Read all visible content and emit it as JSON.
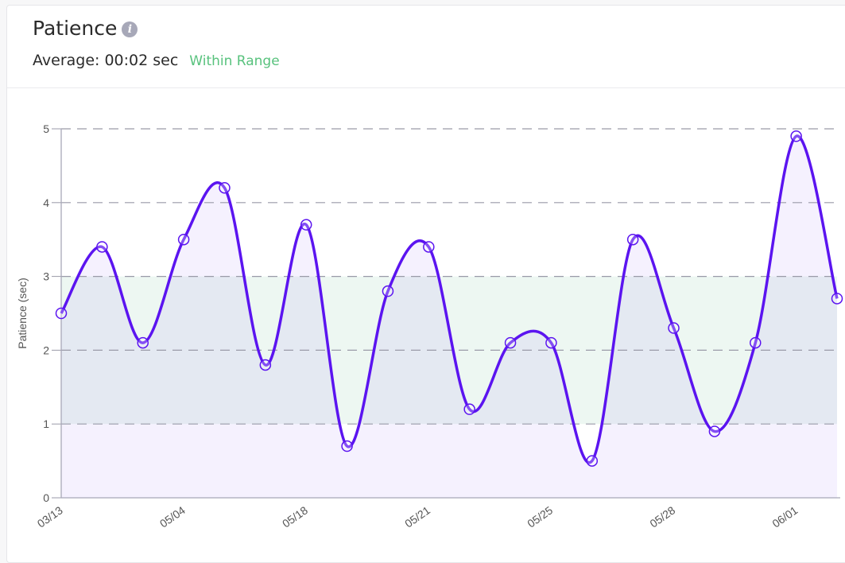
{
  "header": {
    "title": "Patience",
    "info_icon": "info-icon",
    "average_label": "Average: 00:02 sec",
    "status_label": "Within Range",
    "status_color": "#58c27d"
  },
  "colors": {
    "line": "#5b14f0",
    "area": "#f3effd",
    "range_band": "#edf7f2",
    "overlap": "#e5ebf6",
    "grid": "#9a9aa8"
  },
  "chart_data": {
    "type": "area",
    "title": "Patience",
    "xlabel": "",
    "ylabel": "Patience (sec)",
    "ylim": [
      0,
      5
    ],
    "yticks": [
      0,
      1,
      2,
      3,
      4,
      5
    ],
    "grid": true,
    "target_range": [
      1,
      3
    ],
    "x_tick_labels": [
      {
        "index": 0,
        "label": "03/13"
      },
      {
        "index": 3,
        "label": "05/04"
      },
      {
        "index": 6,
        "label": "05/18"
      },
      {
        "index": 9,
        "label": "05/21"
      },
      {
        "index": 12,
        "label": "05/25"
      },
      {
        "index": 15,
        "label": "05/28"
      },
      {
        "index": 18,
        "label": "06/01"
      }
    ],
    "series": [
      {
        "name": "Patience",
        "values": [
          2.5,
          3.4,
          2.1,
          3.5,
          4.2,
          1.8,
          3.7,
          0.7,
          2.8,
          3.4,
          1.2,
          2.1,
          2.1,
          0.5,
          3.5,
          2.3,
          0.9,
          2.1,
          4.9,
          2.7
        ]
      }
    ]
  }
}
